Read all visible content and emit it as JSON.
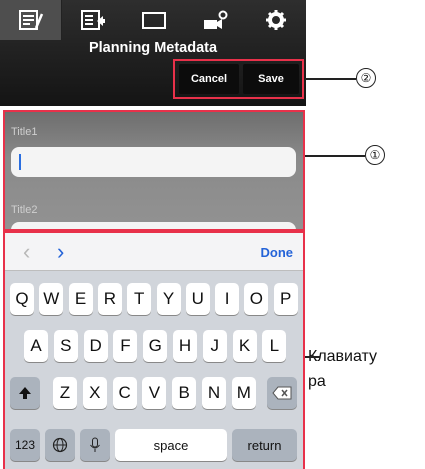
{
  "app": {
    "title": "Planning Metadata",
    "tabs": [
      {
        "icon": "list-edit-icon",
        "active": true
      },
      {
        "icon": "list-export-icon",
        "active": false
      },
      {
        "icon": "rectangle-icon",
        "active": false
      },
      {
        "icon": "camera-settings-icon",
        "active": false
      },
      {
        "icon": "gear-icon",
        "active": false
      }
    ],
    "cancel_label": "Cancel",
    "save_label": "Save"
  },
  "form": {
    "field1_label": "Title1",
    "field1_value": "",
    "field2_label": "Title2"
  },
  "keyboard": {
    "done_label": "Done",
    "row1": [
      "Q",
      "W",
      "E",
      "R",
      "T",
      "Y",
      "U",
      "I",
      "O",
      "P"
    ],
    "row2": [
      "A",
      "S",
      "D",
      "F",
      "G",
      "H",
      "J",
      "K",
      "L"
    ],
    "row3": [
      "Z",
      "X",
      "C",
      "V",
      "B",
      "N",
      "M"
    ],
    "numbers_label": "123",
    "space_label": "space",
    "return_label": "return"
  },
  "annotations": {
    "callout1": "①",
    "callout2": "②",
    "keyboard_label_line1": "Клавиату",
    "keyboard_label_line2": "ра"
  },
  "colors": {
    "highlight": "#e8314a",
    "accent_blue": "#2463d8"
  }
}
